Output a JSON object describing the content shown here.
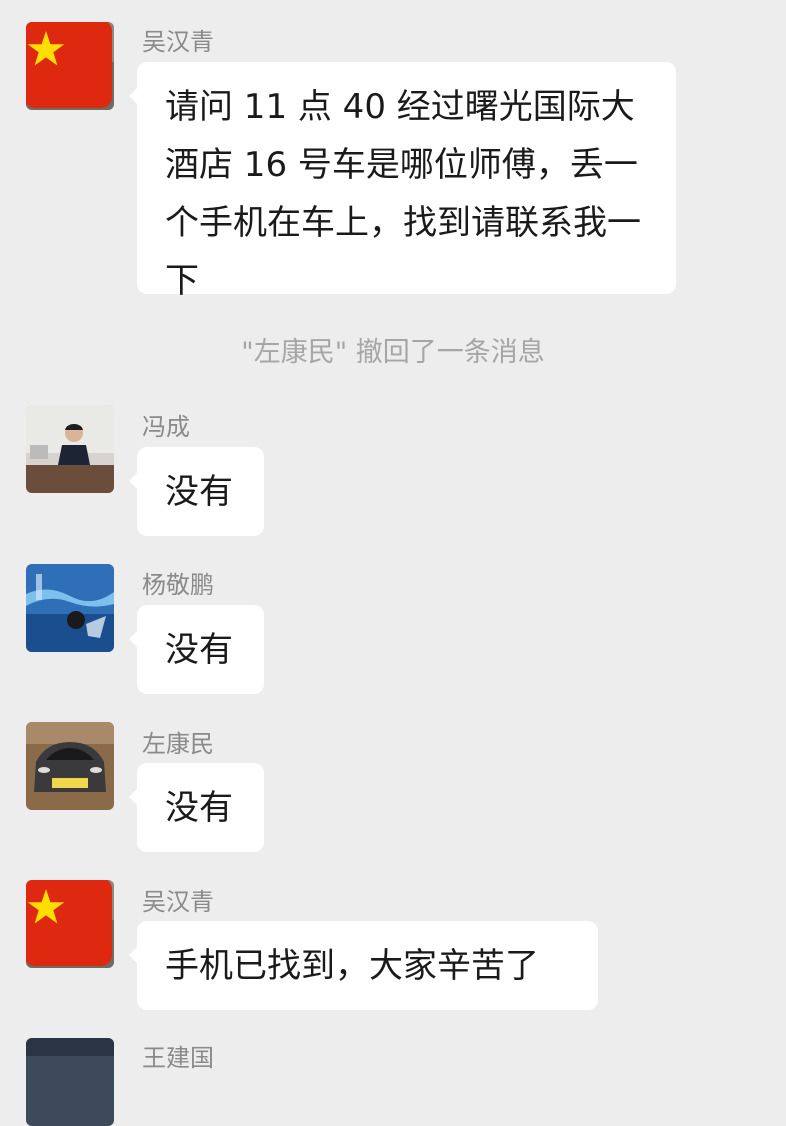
{
  "recall_notice": "\"左康民\" 撤回了一条消息",
  "messages": [
    {
      "sender": "吴汉青",
      "text": "请问 11 点 40 经过曙光国际大酒店 16 号车是哪位师傅，丢一个手机在车上，找到请联系我一下",
      "avatar": "motorcycle-avatar"
    },
    {
      "sender": "冯成",
      "text": "没有",
      "avatar": "man-at-desk-avatar"
    },
    {
      "sender": "杨敬鹏",
      "text": "没有",
      "avatar": "blue-water-avatar"
    },
    {
      "sender": "左康民",
      "text": "没有",
      "avatar": "car-avatar"
    },
    {
      "sender": "吴汉青",
      "text": "手机已找到，大家辛苦了",
      "avatar": "motorcycle-avatar"
    },
    {
      "sender": "王建国",
      "avatar": "dark-avatar"
    }
  ],
  "colors": {
    "background": "#ededed",
    "bubble": "#ffffff",
    "sender": "#8a8a8a",
    "notice": "#a6a6a6"
  }
}
